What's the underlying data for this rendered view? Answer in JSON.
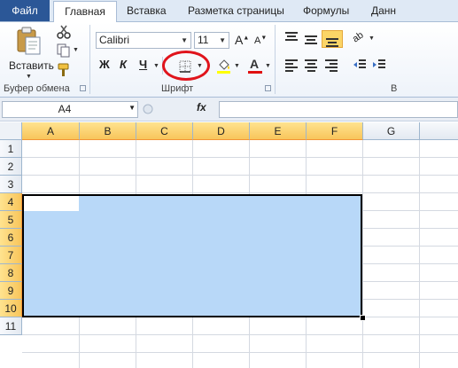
{
  "tabs": {
    "file": "Файл",
    "home": "Главная",
    "insert": "Вставка",
    "page_layout": "Разметка страницы",
    "formulas": "Формулы",
    "data": "Данн"
  },
  "ribbon": {
    "clipboard": {
      "paste_label": "Вставить",
      "group_label": "Буфер обмена"
    },
    "font": {
      "font_name": "Calibri",
      "font_size": "11",
      "bold": "Ж",
      "italic": "К",
      "underline": "Ч",
      "font_color_letter": "A",
      "group_label": "Шрифт"
    },
    "alignment": {
      "group_label": "В"
    }
  },
  "formula_bar": {
    "name_box": "A4",
    "fx": "fx",
    "formula": ""
  },
  "sheet": {
    "columns": [
      "A",
      "B",
      "C",
      "D",
      "E",
      "F",
      "G"
    ],
    "rows": [
      "1",
      "2",
      "3",
      "4",
      "5",
      "6",
      "7",
      "8",
      "9",
      "10",
      "11"
    ],
    "active_cell": "A4",
    "selected_range": "A4:F10"
  },
  "colors": {
    "file_tab": "#2b5797",
    "selection_fill": "#b8d8f8",
    "header_selected": "#f8c55b",
    "highlight_oval": "#e0141c"
  }
}
